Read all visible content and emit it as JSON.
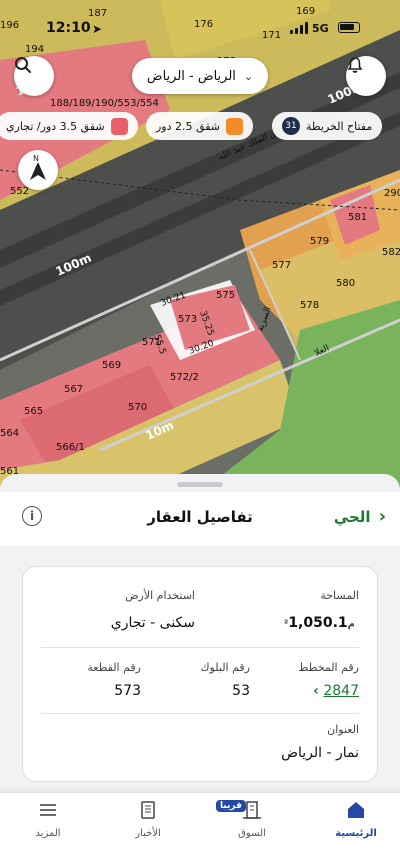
{
  "status_bar": {
    "time": "12:10",
    "network": "5G"
  },
  "map": {
    "city_selector": "الرياض - الرياض",
    "legend": {
      "key_label": "مفتاح الخريطة",
      "key_count": "31",
      "item1": "شقق 2.5 دور",
      "item2": "شقق 3.5 دور/ تجاري",
      "item1_color": "#f28c28",
      "item2_color": "#e8606a"
    },
    "top_strip_label": "188/189/190/553/554",
    "road_labels": [
      "100m",
      "10m",
      "10m"
    ],
    "street_labels": [
      "طريق الملك عبد الله",
      "السرية",
      "العلا"
    ],
    "dimension_labels": [
      "30.21",
      "35.25",
      "55.5",
      "30.20"
    ],
    "plot_numbers": [
      "187",
      "169",
      "176",
      "171",
      "173",
      "194",
      "196",
      "552",
      "290",
      "581",
      "582",
      "579",
      "577",
      "580",
      "578",
      "575",
      "573",
      "571",
      "572/2",
      "569",
      "567",
      "570",
      "565",
      "566/1",
      "564",
      "561"
    ]
  },
  "sheet": {
    "back_label": "الحي",
    "title": "تفاصيل العقار",
    "area_label": "المساحة",
    "area_value": "1,050.1",
    "area_unit": "م²",
    "land_use_label": "استخدام الأرض",
    "land_use_value": "سكنى - تجاري",
    "plan_label": "رقم المخطط",
    "plan_value": "2847",
    "block_label": "رقم البلوك",
    "block_value": "53",
    "parcel_label": "رقم القطعة",
    "parcel_value": "573",
    "address_label": "العنوان",
    "address_value": "نمار - الرياض"
  },
  "tabbar": {
    "home": "الرئيسية",
    "market": "السوق",
    "market_badge": "قريبا",
    "news": "الأخبار",
    "more": "المزيد",
    "active_color": "#2548a5"
  }
}
